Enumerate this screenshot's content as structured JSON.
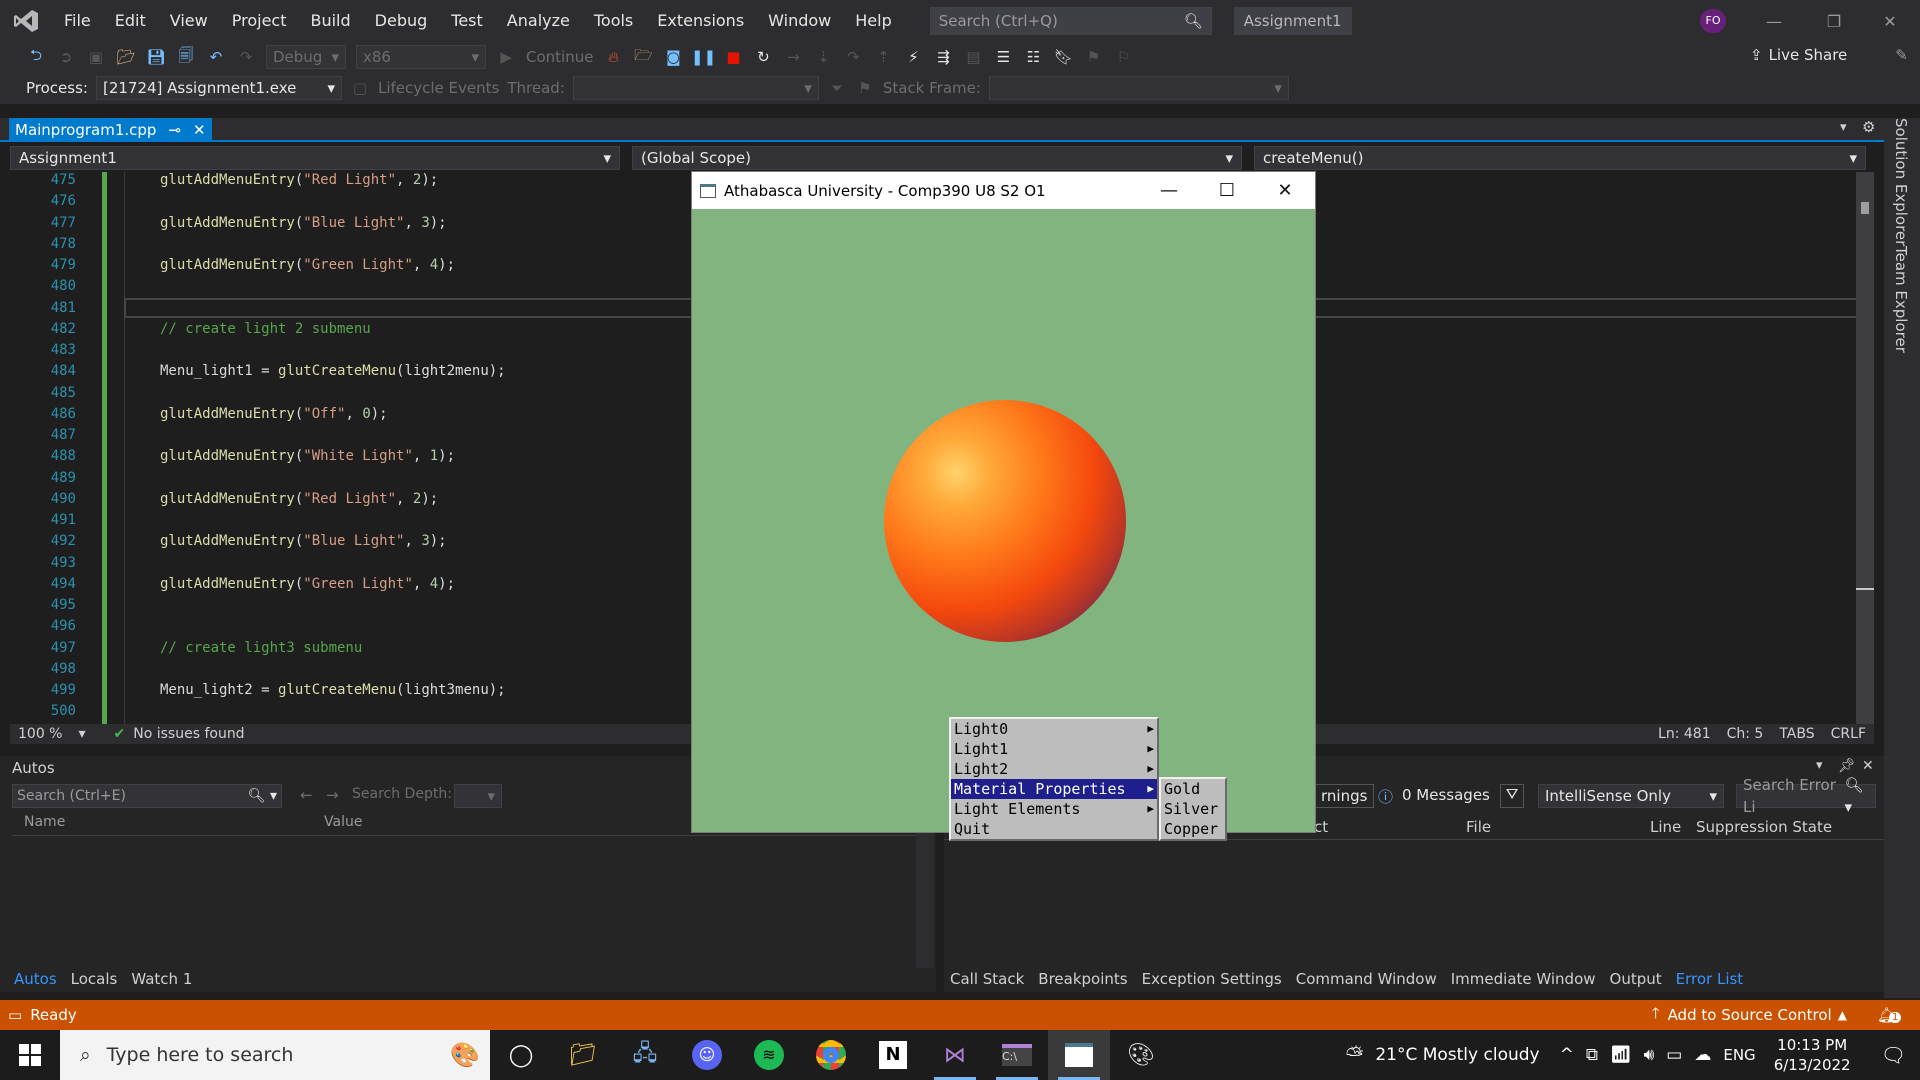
{
  "menubar": {
    "items": [
      "File",
      "Edit",
      "View",
      "Project",
      "Build",
      "Debug",
      "Test",
      "Analyze",
      "Tools",
      "Extensions",
      "Window",
      "Help"
    ],
    "search_placeholder": "Search (Ctrl+Q)",
    "solution_name": "Assignment1",
    "avatar_initials": "FO"
  },
  "toolbar": {
    "config": "Debug",
    "platform": "x86",
    "continue_label": "Continue",
    "live_share": "Live Share",
    "process_label": "Process:",
    "process_value": "[21724] Assignment1.exe",
    "lifecycle_label": "Lifecycle Events",
    "thread_label": "Thread:",
    "stack_frame_label": "Stack Frame:"
  },
  "doc_tab": {
    "name": "Mainprogram1.cpp",
    "pin": "⊸",
    "close": "✕"
  },
  "navbar": {
    "project": "Assignment1",
    "scope": "(Global Scope)",
    "member": "createMenu()"
  },
  "editor": {
    "lines": [
      {
        "n": "475",
        "parts": [
          [
            "fn",
            "glutAddMenuEntry"
          ],
          [
            "p",
            "("
          ],
          [
            "str",
            "\"Red Light\""
          ],
          [
            "p",
            ", "
          ],
          [
            "num",
            "2"
          ],
          [
            "p",
            ");"
          ]
        ]
      },
      {
        "n": "476",
        "parts": []
      },
      {
        "n": "477",
        "parts": [
          [
            "fn",
            "glutAddMenuEntry"
          ],
          [
            "p",
            "("
          ],
          [
            "str",
            "\"Blue Light\""
          ],
          [
            "p",
            ", "
          ],
          [
            "num",
            "3"
          ],
          [
            "p",
            ");"
          ]
        ]
      },
      {
        "n": "478",
        "parts": []
      },
      {
        "n": "479",
        "parts": [
          [
            "fn",
            "glutAddMenuEntry"
          ],
          [
            "p",
            "("
          ],
          [
            "str",
            "\"Green Light\""
          ],
          [
            "p",
            ", "
          ],
          [
            "num",
            "4"
          ],
          [
            "p",
            ");"
          ]
        ]
      },
      {
        "n": "480",
        "parts": []
      },
      {
        "n": "481",
        "parts": []
      },
      {
        "n": "482",
        "parts": [
          [
            "cmt",
            "// create light 2 submenu"
          ]
        ]
      },
      {
        "n": "483",
        "parts": []
      },
      {
        "n": "484",
        "parts": [
          [
            "var",
            "Menu_light1"
          ],
          [
            "p",
            " = "
          ],
          [
            "fn",
            "glutCreateMenu"
          ],
          [
            "p",
            "(light2menu);"
          ]
        ]
      },
      {
        "n": "485",
        "parts": []
      },
      {
        "n": "486",
        "parts": [
          [
            "fn",
            "glutAddMenuEntry"
          ],
          [
            "p",
            "("
          ],
          [
            "str",
            "\"Off\""
          ],
          [
            "p",
            ", "
          ],
          [
            "num",
            "0"
          ],
          [
            "p",
            ");"
          ]
        ]
      },
      {
        "n": "487",
        "parts": []
      },
      {
        "n": "488",
        "parts": [
          [
            "fn",
            "glutAddMenuEntry"
          ],
          [
            "p",
            "("
          ],
          [
            "str",
            "\"White Light\""
          ],
          [
            "p",
            ", "
          ],
          [
            "num",
            "1"
          ],
          [
            "p",
            ");"
          ]
        ]
      },
      {
        "n": "489",
        "parts": []
      },
      {
        "n": "490",
        "parts": [
          [
            "fn",
            "glutAddMenuEntry"
          ],
          [
            "p",
            "("
          ],
          [
            "str",
            "\"Red Light\""
          ],
          [
            "p",
            ", "
          ],
          [
            "num",
            "2"
          ],
          [
            "p",
            ");"
          ]
        ]
      },
      {
        "n": "491",
        "parts": []
      },
      {
        "n": "492",
        "parts": [
          [
            "fn",
            "glutAddMenuEntry"
          ],
          [
            "p",
            "("
          ],
          [
            "str",
            "\"Blue Light\""
          ],
          [
            "p",
            ", "
          ],
          [
            "num",
            "3"
          ],
          [
            "p",
            ");"
          ]
        ]
      },
      {
        "n": "493",
        "parts": []
      },
      {
        "n": "494",
        "parts": [
          [
            "fn",
            "glutAddMenuEntry"
          ],
          [
            "p",
            "("
          ],
          [
            "str",
            "\"Green Light\""
          ],
          [
            "p",
            ", "
          ],
          [
            "num",
            "4"
          ],
          [
            "p",
            ");"
          ]
        ]
      },
      {
        "n": "495",
        "parts": []
      },
      {
        "n": "496",
        "parts": []
      },
      {
        "n": "497",
        "parts": [
          [
            "cmt",
            "// create light3 submenu"
          ]
        ]
      },
      {
        "n": "498",
        "parts": []
      },
      {
        "n": "499",
        "parts": [
          [
            "var",
            "Menu_light2"
          ],
          [
            "p",
            " = "
          ],
          [
            "fn",
            "glutCreateMenu"
          ],
          [
            "p",
            "(light3menu);"
          ]
        ]
      },
      {
        "n": "500",
        "parts": []
      }
    ],
    "zoom": "100 %",
    "issues": "No issues found",
    "ln": "Ln: 481",
    "ch": "Ch: 5",
    "tabs": "TABS",
    "eol": "CRLF"
  },
  "autos": {
    "title": "Autos",
    "search_placeholder": "Search (Ctrl+E)",
    "depth_label": "Search Depth:",
    "col_name": "Name",
    "col_value": "Value",
    "tabs": [
      "Autos",
      "Locals",
      "Watch 1"
    ]
  },
  "errorlist": {
    "warnings_fragment": "rnings",
    "messages": "0 Messages",
    "filter": "IntelliSense Only",
    "search_placeholder": "Search Error Li",
    "col_project_fragment": "ct",
    "col_file": "File",
    "col_line": "Line",
    "col_suppression": "Suppression State",
    "tabs": [
      "Call Stack",
      "Breakpoints",
      "Exception Settings",
      "Command Window",
      "Immediate Window",
      "Output",
      "Error List"
    ]
  },
  "sidebar": {
    "tabs": [
      "Solution Explorer",
      "Team Explorer"
    ]
  },
  "statusbar": {
    "ready": "Ready",
    "source_control": "Add to Source Control",
    "notifications": "1"
  },
  "glut_window": {
    "title": "Athabasca University - Comp390 U8 S2 O1",
    "menu": [
      "Light0",
      "Light1",
      "Light2",
      "Material Properties",
      "Light Elements",
      "Quit"
    ],
    "submenu": [
      "Gold",
      "Silver",
      "Copper"
    ]
  },
  "taskbar": {
    "search_placeholder": "Type here to search",
    "weather": "21°C  Mostly cloudy",
    "lang": "ENG",
    "time": "10:13 PM",
    "date": "6/13/2022"
  },
  "colors": {
    "accent": "#007acc",
    "statusbar": "#ca5100",
    "glut_bg": "#82b47f",
    "menu_highlight": "#1e1e8c"
  }
}
